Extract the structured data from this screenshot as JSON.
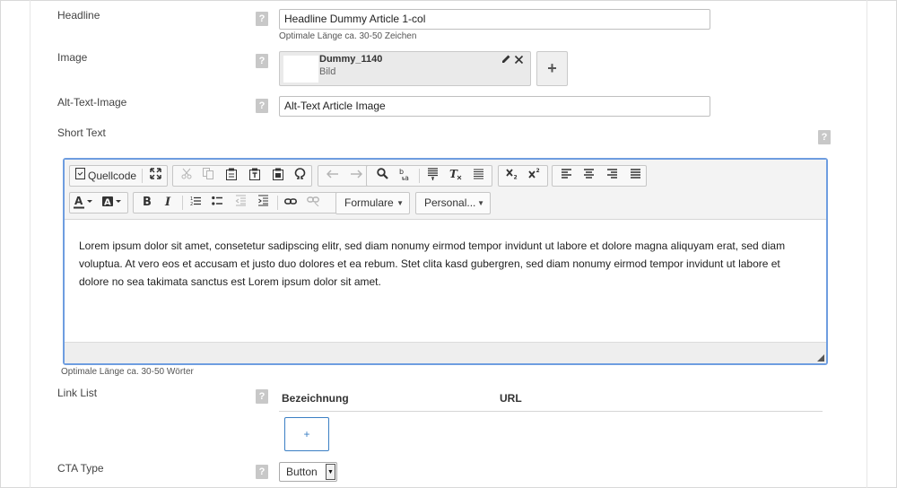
{
  "fields": {
    "headline": {
      "label": "Headline",
      "value": "Headline Dummy Article 1-col",
      "hint": "Optimale Länge ca. 30-50 Zeichen"
    },
    "image": {
      "label": "Image",
      "name": "Dummy_1140",
      "type": "Bild",
      "add_label": "+"
    },
    "alt_text": {
      "label": "Alt-Text-Image",
      "value": "Alt-Text Article Image"
    },
    "short_text": {
      "label": "Short Text",
      "hint": "Optimale Länge ca. 30-50 Wörter",
      "content": "Lorem ipsum dolor sit amet, consetetur sadipscing elitr, sed diam nonumy eirmod tempor invidunt ut labore et dolore magna aliquyam erat, sed diam voluptua. At vero eos et accusam et justo duo dolores et ea rebum. Stet clita kasd gubergren, sed diam nonumy eirmod tempor invidunt ut labore et dolore no sea takimata sanctus est Lorem ipsum dolor sit amet."
    },
    "link_list": {
      "label": "Link List",
      "col_name": "Bezeichnung",
      "col_url": "URL",
      "add_label": "+"
    },
    "cta_type": {
      "label": "CTA Type",
      "selected": "Button"
    }
  },
  "help_icon": "?",
  "editor_toolbar": {
    "source_label": "Quellcode",
    "format_combo": "Formulare",
    "styles_combo": "Personal...",
    "source_icon": "source-doc-icon",
    "maximize_icon": "maximize-icon",
    "cut_icon": "cut-icon",
    "copy_icon": "copy-icon",
    "paste_icon": "paste-icon",
    "paste_text_icon": "paste-text-icon",
    "paste_word_icon": "paste-word-icon",
    "special_char_icon": "omega-icon",
    "undo_icon": "undo-icon",
    "redo_icon": "redo-icon",
    "find_icon": "search-icon",
    "replace_icon": "replace-icon",
    "select_all_icon": "select-all-icon",
    "remove_format_icon": "remove-format-icon",
    "hr_icon": "horizontal-rule-icon",
    "subscript_icon": "subscript-icon",
    "superscript_icon": "superscript-icon",
    "align_left_icon": "align-left-icon",
    "align_center_icon": "align-center-icon",
    "align_right_icon": "align-right-icon",
    "justify_icon": "align-justify-icon",
    "text_color_icon": "text-color-icon",
    "bg_color_icon": "background-color-icon",
    "bold_icon": "bold-icon",
    "italic_icon": "italic-icon",
    "numbered_list_icon": "numbered-list-icon",
    "bullet_list_icon": "bullet-list-icon",
    "outdent_icon": "outdent-icon",
    "indent_icon": "indent-icon",
    "link_icon": "link-icon",
    "unlink_icon": "unlink-icon"
  },
  "colors": {
    "editor_focus": "#6e9de0",
    "add_link_accent": "#3b7fc4"
  }
}
